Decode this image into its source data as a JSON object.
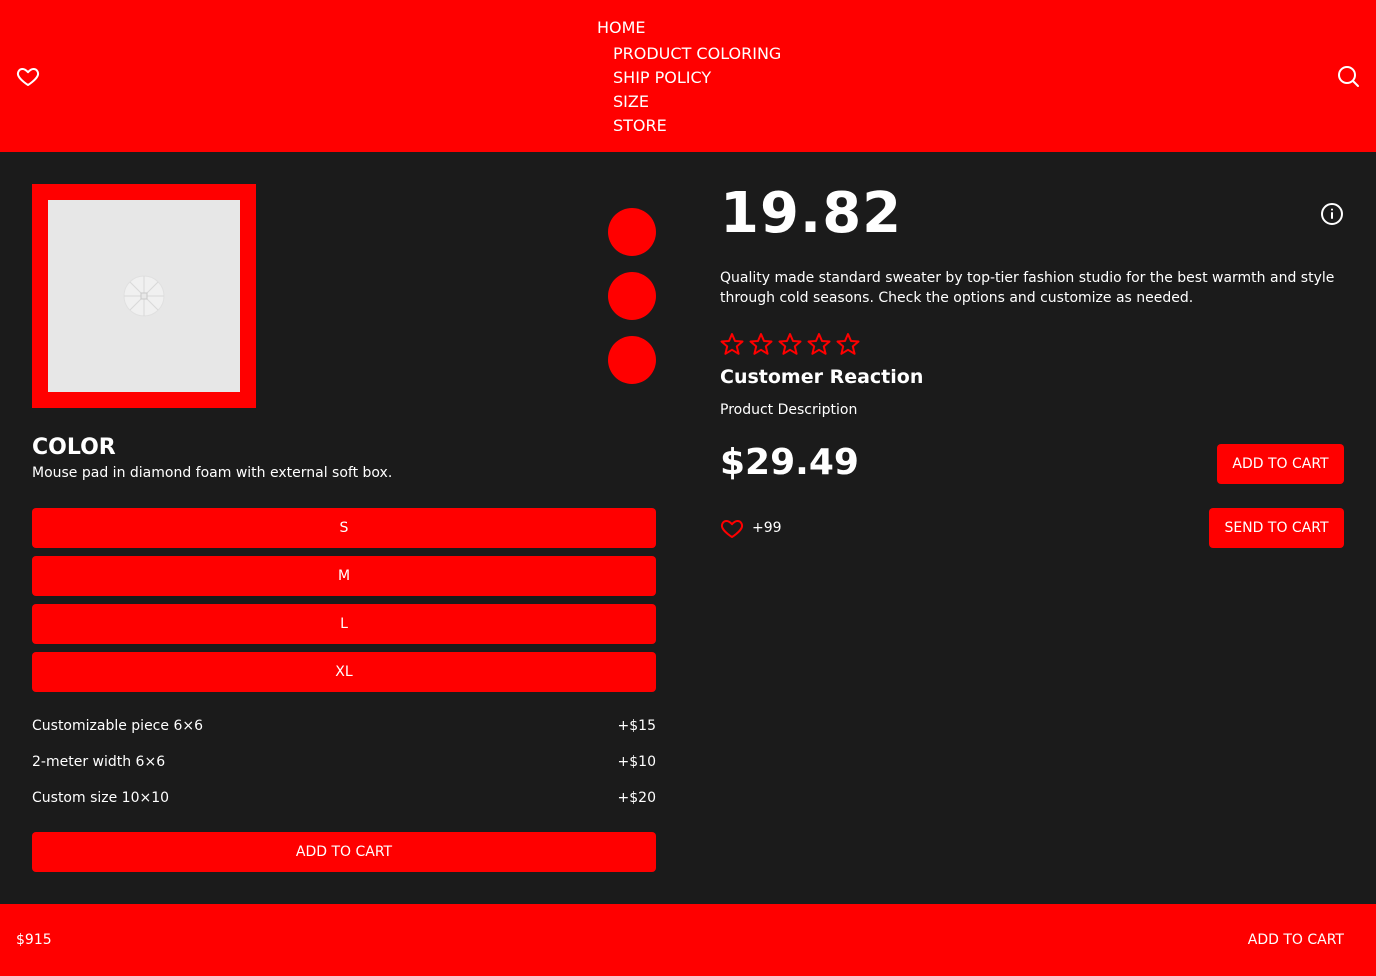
{
  "header": {
    "nav_home": "HOME",
    "nav_items": [
      "PRODUCT COLORING",
      "SHIP POLICY",
      "SIZE",
      "STORE"
    ],
    "icons": {
      "favorites": "heart-icon",
      "search": "search-icon"
    }
  },
  "product": {
    "image_placeholder": "image-placeholder-icon",
    "swatches": [
      {
        "color": "#ff0000"
      },
      {
        "color": "#ff0000"
      },
      {
        "color": "#ff0000"
      }
    ],
    "color_title": "COLOR",
    "color_desc": "Mouse pad in diamond foam with external soft box.",
    "sizes": [
      "S",
      "M",
      "L",
      "XL"
    ],
    "options": [
      {
        "label": "Customizable piece 6×6",
        "price": "+$15"
      },
      {
        "label": "2-meter width 6×6",
        "price": "+$10"
      },
      {
        "label": "Custom size 10×10",
        "price": "+$20"
      }
    ],
    "add_to_cart_label": "ADD TO CART"
  },
  "details": {
    "price_big": "19.82",
    "info_icon": "info-icon",
    "description": "Quality made standard sweater by top-tier fashion studio for the best warmth and style through cold seasons. Check the options and customize as needed.",
    "rating": {
      "value": 0,
      "max": 5
    },
    "reaction_title": "Customer Reaction",
    "reaction_sub": "Product Description",
    "price": "$29.49",
    "add_to_cart_label": "ADD TO CART",
    "send_to_cart_label": "SEND TO CART",
    "likes": "+99"
  },
  "footer": {
    "total": "$915",
    "add_to_cart_label": "ADD TO CART"
  },
  "colors": {
    "accent": "#ff0000",
    "background": "#1b1b1b",
    "text": "#ffffff"
  }
}
